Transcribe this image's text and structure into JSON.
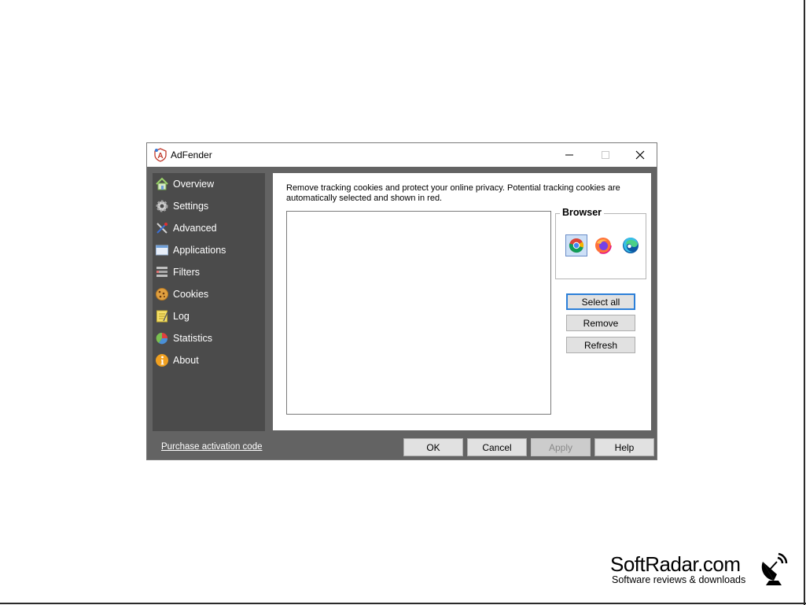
{
  "window": {
    "title": "AdFender"
  },
  "sidebar": {
    "items": [
      {
        "label": "Overview",
        "icon": "house-icon"
      },
      {
        "label": "Settings",
        "icon": "gear-icon"
      },
      {
        "label": "Advanced",
        "icon": "tools-icon"
      },
      {
        "label": "Applications",
        "icon": "window-icon"
      },
      {
        "label": "Filters",
        "icon": "filter-icon"
      },
      {
        "label": "Cookies",
        "icon": "cookie-icon"
      },
      {
        "label": "Log",
        "icon": "notepad-icon"
      },
      {
        "label": "Statistics",
        "icon": "pie-chart-icon"
      },
      {
        "label": "About",
        "icon": "info-icon"
      }
    ]
  },
  "content": {
    "description": "Remove tracking cookies and protect your online privacy. Potential tracking cookies are automatically selected and shown in red.",
    "browser_group_label": "Browser",
    "selected_browser": "chrome",
    "buttons": {
      "select_all": "Select all",
      "remove": "Remove",
      "refresh": "Refresh"
    }
  },
  "footer": {
    "purchase_link": "Purchase activation code",
    "ok": "OK",
    "cancel": "Cancel",
    "apply": "Apply",
    "help": "Help"
  },
  "watermark": {
    "title": "SoftRadar.com",
    "subtitle": "Software reviews & downloads"
  },
  "colors": {
    "sidebar_bg": "#4b4b4b",
    "window_bg": "#636363",
    "focus_border": "#2c7fd8"
  }
}
